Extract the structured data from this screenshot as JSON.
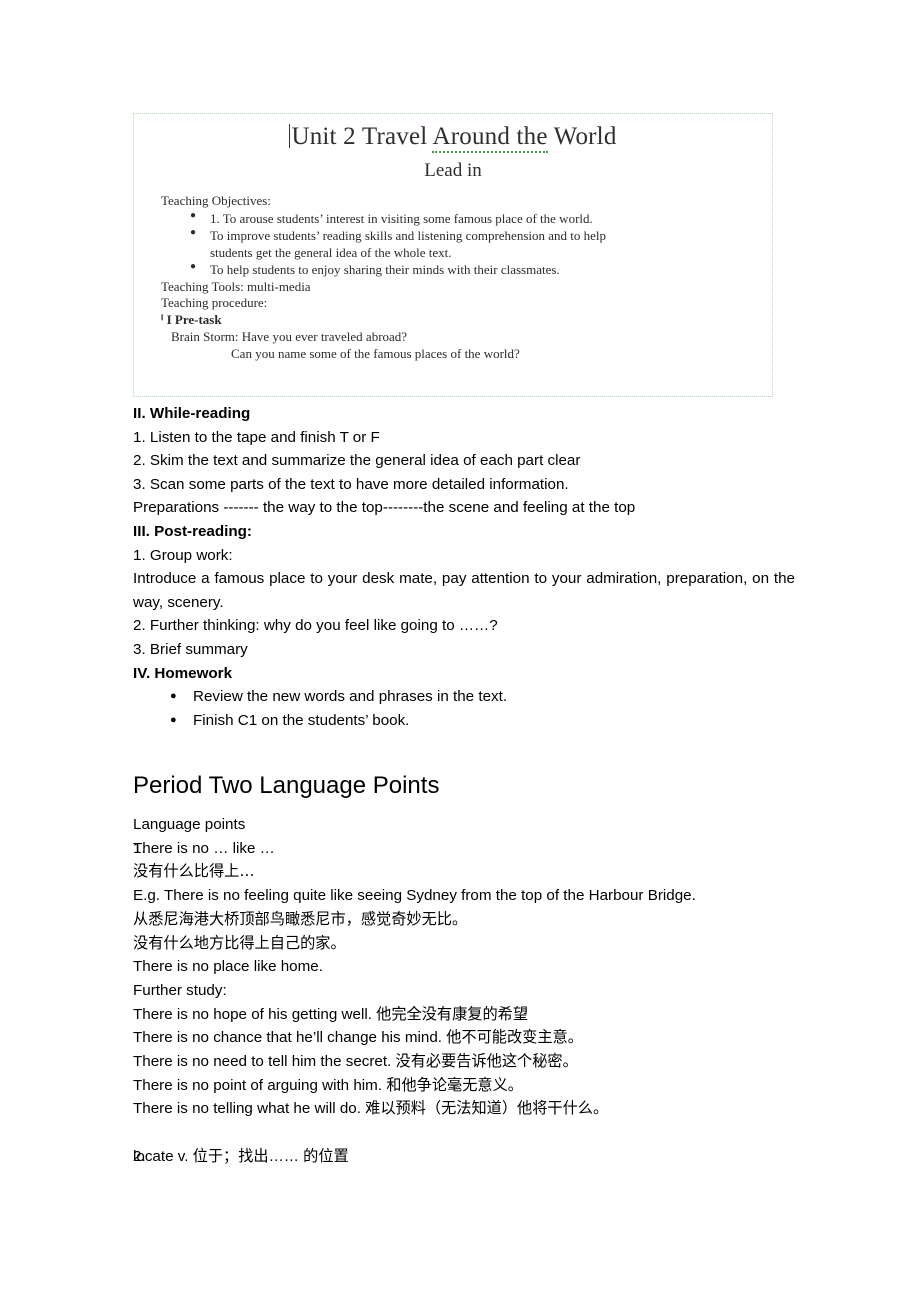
{
  "embedded_image": {
    "title": "Unit 2 Travel Around the World",
    "title_part_a": "Unit 2 Travel ",
    "title_part_b": "Around the",
    "title_part_c": " World",
    "subtitle": "Lead in",
    "objectives_label": "Teaching Objectives:",
    "objectives": [
      "1. To arouse students’    interest in visiting some famous place of the world.",
      "To improve students’    reading skills and listening comprehension and to help",
      "To help students to enjoy sharing their minds with their classmates."
    ],
    "objective_2_cont": "students get the general idea of the whole text.",
    "tools_line": "Teaching Tools: multi-media",
    "procedure_line": "Teaching procedure:",
    "pretask_line": "ⁱ I Pre-task",
    "pretask_label": "I Pre-task",
    "brain_storm": "Brain Storm: Have you ever traveled abroad?",
    "brain_storm_2": "Can you name some of the famous places of the world?",
    "spellcheck_underline_color": "#3f9b3f",
    "border_color": "#b5dcb5"
  },
  "lesson": {
    "section2_heading": "II. While-reading",
    "section2_items": [
      "1. Listen to the tape and finish T or F",
      "2. Skim the text and summarize the general idea of each part clear",
      "3. Scan some parts of the text to have more detailed information."
    ],
    "section2_sub": "Preparations ------- the way to the top--------the scene and feeling at the top",
    "section3_heading": "III. Post-reading:",
    "section3_item1": "1. Group work:",
    "section3_item1_body": "Introduce a famous place to your desk mate, pay attention to your admiration, preparation, on the way, scenery.",
    "section3_item2": "2. Further thinking: why do you feel like going to ……?",
    "section3_item3": "3. Brief summary",
    "section4_heading": "IV. Homework",
    "homework_items": [
      "Review the new words and phrases in the text.",
      "Finish C1 on the students’    book."
    ]
  },
  "period_two": {
    "heading": "Period Two Language Points",
    "subheading": "Language points",
    "point1_num": "1.",
    "point1_text": "There is no … like …",
    "point1_cn": "没有什么比得上…",
    "eg_line": "E.g. There is no feeling quite like seeing Sydney from the top of the Harbour Bridge.",
    "eg_cn1": "从悉尼海港大桥顶部鸟瞰悉尼市，感觉奇妙无比。",
    "eg_cn2": "没有什么地方比得上自己的家。",
    "eg_en2": "There is no place like home.",
    "further_study_label": "Further study:",
    "further_study": [
      "There is no hope of his getting well.  他完全没有康复的希望",
      "There is no chance that he’ll change his mind.  他不可能改变主意。",
      "There is no need to tell him the secret.  没有必要告诉他这个秘密。",
      "There is no point of arguing with him.  和他争论毫无意义。",
      "There is no telling what he will do.  难以预料（无法知道）他将干什么。"
    ],
    "point2_num": "2.",
    "point2_text": "locate v.  位于；找出…… 的位置"
  }
}
